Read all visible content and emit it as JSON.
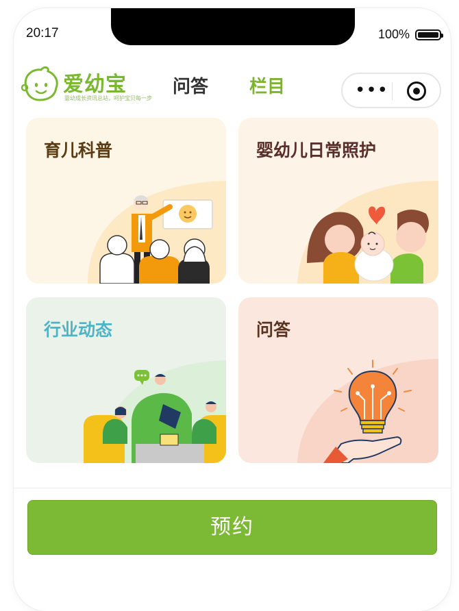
{
  "status_bar": {
    "time": "20:17",
    "battery_text": "100%"
  },
  "header": {
    "logo_text": "爱幼宝",
    "logo_subtitle": "婴幼成长资讯总站，呵护宝贝每一步",
    "tabs": [
      {
        "label": "问答",
        "active": false
      },
      {
        "label": "栏目",
        "active": true
      }
    ],
    "capsule": {
      "more_icon": "more-dots-icon",
      "close_icon": "target-icon"
    }
  },
  "cards": [
    {
      "title": "育儿科普",
      "title_color": "#5a3b12",
      "bg": "#fdf5e6"
    },
    {
      "title": "婴幼儿日常照护",
      "title_color": "#5a2e2a",
      "bg": "#fdf3e6"
    },
    {
      "title": "行业动态",
      "title_color": "#4db3c7",
      "bg": "#eaf2ea"
    },
    {
      "title": "问答",
      "title_color": "#5a3423",
      "bg": "#fce7df"
    }
  ],
  "footer": {
    "book_button_label": "预约"
  },
  "colors": {
    "accent": "#7cb934",
    "tab_active": "#7cb430"
  }
}
